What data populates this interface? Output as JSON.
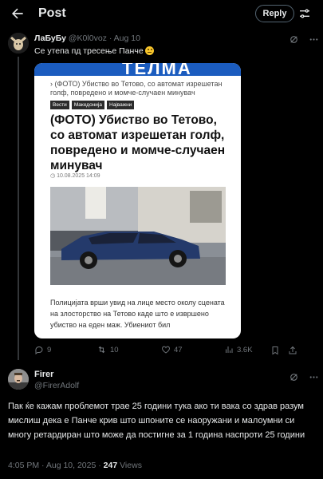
{
  "header": {
    "title": "Post",
    "reply_label": "Reply"
  },
  "parent_tweet": {
    "display_name": "ЛаБуБу",
    "handle": "@K0l0voz",
    "date_label": "· Aug 10",
    "text": "Се утепа пд тресење Панче",
    "image": {
      "site_logo": "ТЕЛМА",
      "breadcrumb": "› (ФОТО) Убиство во Тетово, со автомат изрешетан голф, повредено и момче-случаен минувач",
      "tags": [
        "Вести",
        "Македонија",
        "Најважни"
      ],
      "headline": "(ФОТО) Убиство во Тетово, со автомат изрешетан голф, повредено и момче-случаен минувач",
      "pubdate": "10.08.2025 14:09",
      "body": "Полицијата врши увид на лице место околу сцената на злосторство на Тетово каде што е извршено убиство на еден маж. Убиениот бил"
    },
    "stats": {
      "replies": "9",
      "reposts": "10",
      "likes": "47",
      "views": "3.6K"
    }
  },
  "main_tweet": {
    "display_name": "Firer",
    "handle": "@FirerAdolf",
    "text": "Пак ќе кажам проблемот трае 25 години тука ако ти вака со здрав разум мислиш дека е Панче крив што шпоните се наоружани и малоумни си многу ретардиран што може да постигне за 1 година наспроти 25 години",
    "timestamp": "4:05 PM · Aug 10, 2025 · ",
    "views_count": "247",
    "views_label": " Views"
  },
  "colors": {
    "background": "#000000",
    "text": "#e7e9ea",
    "muted": "#71767b",
    "border": "#536471",
    "site_blue": "#1b5cbf"
  }
}
